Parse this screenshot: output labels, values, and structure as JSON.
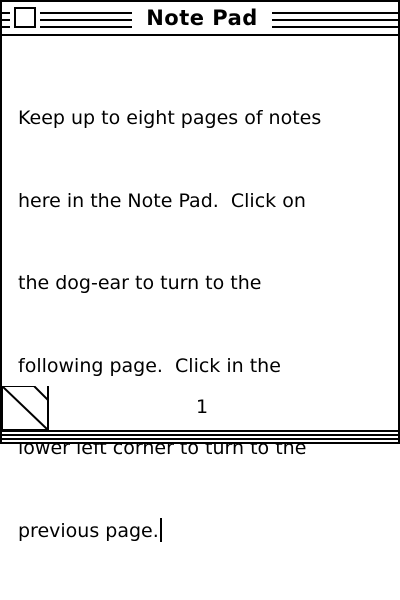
{
  "window": {
    "title": "Note Pad"
  },
  "note": {
    "lines": [
      "Keep up to eight pages of notes",
      "here in the Note Pad.  Click on",
      "the dog-ear to turn to the",
      "following page.  Click in the",
      "lower left corner to turn to the",
      "previous page."
    ],
    "page_number": "1"
  }
}
